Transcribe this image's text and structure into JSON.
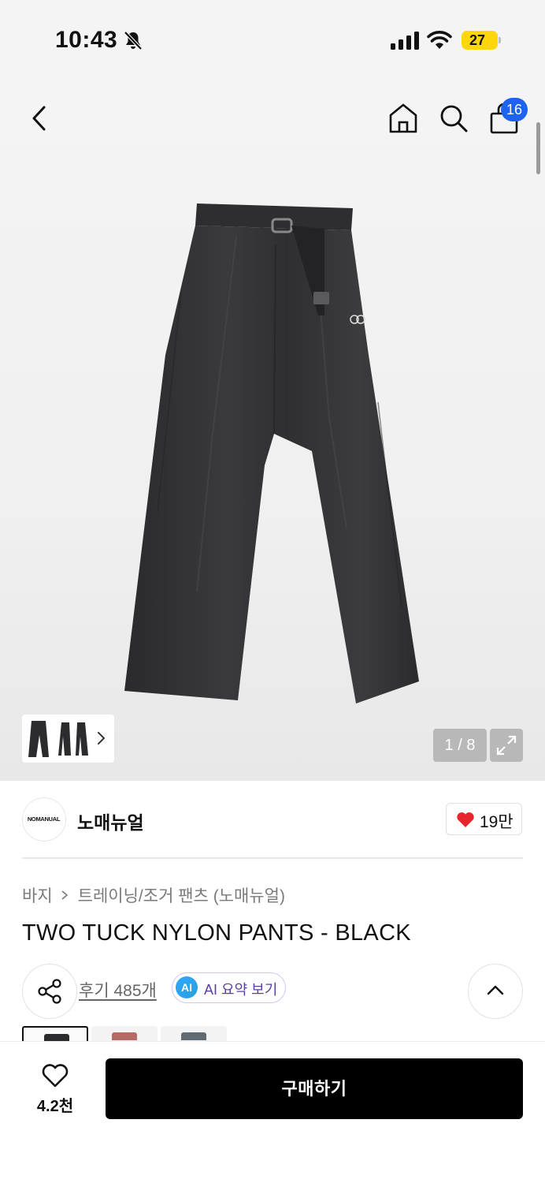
{
  "status_bar": {
    "time": "10:43",
    "battery": "27",
    "battery_color": "#ffd60a"
  },
  "nav": {
    "bag_count": "16",
    "badge_color": "#1e63f0"
  },
  "gallery": {
    "counter": "1 / 8"
  },
  "brand": {
    "logo_text": "NOMANUAL",
    "name": "노매뉴얼",
    "likes": "19만"
  },
  "breadcrumb": {
    "category": "바지",
    "subcategory": "트레이닝/조거 팬츠 (노매뉴얼)"
  },
  "product": {
    "title": "TWO TUCK NYLON PANTS - BLACK"
  },
  "actions": {
    "reviews": "후기 485개",
    "ai_badge": "AI",
    "ai_summary": "AI 요약 보기"
  },
  "bottom_bar": {
    "wish_count": "4.2천",
    "buy_label": "구매하기"
  },
  "icons": [
    "bell-off-icon",
    "signal-icon",
    "wifi-icon",
    "back-arrow-icon",
    "home-icon",
    "search-icon",
    "shopping-bag-icon",
    "expand-icon",
    "chevron-right-icon",
    "heart-icon",
    "share-icon",
    "chevron-up-icon",
    "heart-outline-icon"
  ]
}
